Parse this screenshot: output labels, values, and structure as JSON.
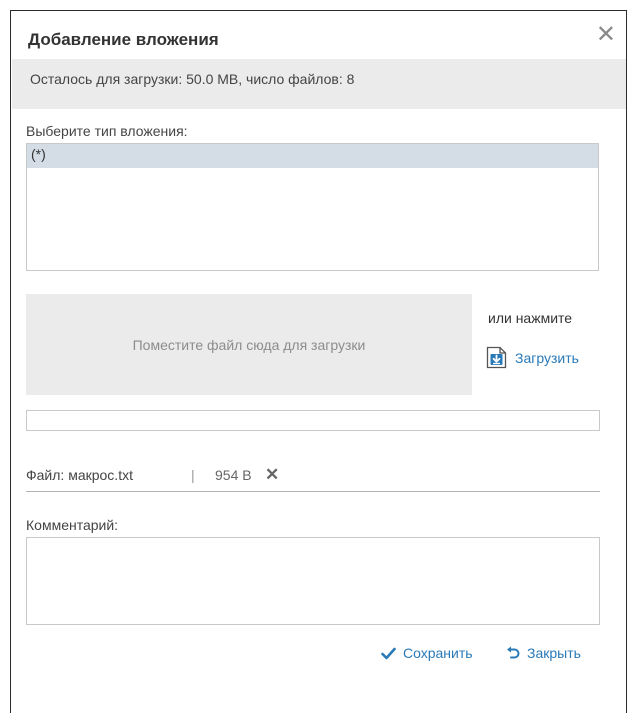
{
  "dialog": {
    "title": "Добавление вложения",
    "close_glyph": "✕"
  },
  "info": {
    "text": "Осталось для загрузки: 50.0 MB, число файлов: 8"
  },
  "attachment_type": {
    "label": "Выберите тип вложения:",
    "options": [
      "(*)"
    ]
  },
  "upload": {
    "drop_text": "Поместите файл сюда для загрузки",
    "or_text": "или нажмите",
    "button_label": "Загрузить",
    "icon": "download-icon"
  },
  "file": {
    "name_text": "Файл: макрос.txt",
    "separator": "|",
    "size_text": "954 B",
    "remove_glyph": "✕"
  },
  "comment": {
    "label": "Комментарий:",
    "value": ""
  },
  "actions": {
    "save_label": "Сохранить",
    "close_label": "Закрыть",
    "save_icon": "checkmark-icon",
    "close_icon": "undo-arrow-icon"
  },
  "colors": {
    "accent": "#2a7ab8",
    "selection": "#d4dce6",
    "panel": "#ebebeb"
  }
}
